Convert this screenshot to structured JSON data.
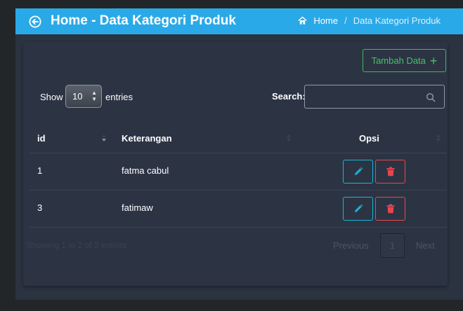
{
  "header": {
    "title": "Home - Data Kategori Produk",
    "breadcrumb": {
      "home": "Home",
      "separator": "/",
      "current": "Data Kategori Produk"
    },
    "accent": "#2aa9e8"
  },
  "toolbar": {
    "add_label": "Tambah Data",
    "add_icon": "plus"
  },
  "length": {
    "show_label": "Show",
    "value": "10",
    "entries_label": "entries"
  },
  "search": {
    "label": "Search:",
    "placeholder": ""
  },
  "table": {
    "columns": [
      "id",
      "Keterangan",
      "Opsi"
    ],
    "rows": [
      {
        "id": "1",
        "keterangan": "fatma cabul"
      },
      {
        "id": "3",
        "keterangan": "fatimaw"
      }
    ]
  },
  "footer": {
    "info": "Showing 1 to 2 of 2 entries",
    "previous": "Previous",
    "page": "1",
    "next": "Next"
  }
}
